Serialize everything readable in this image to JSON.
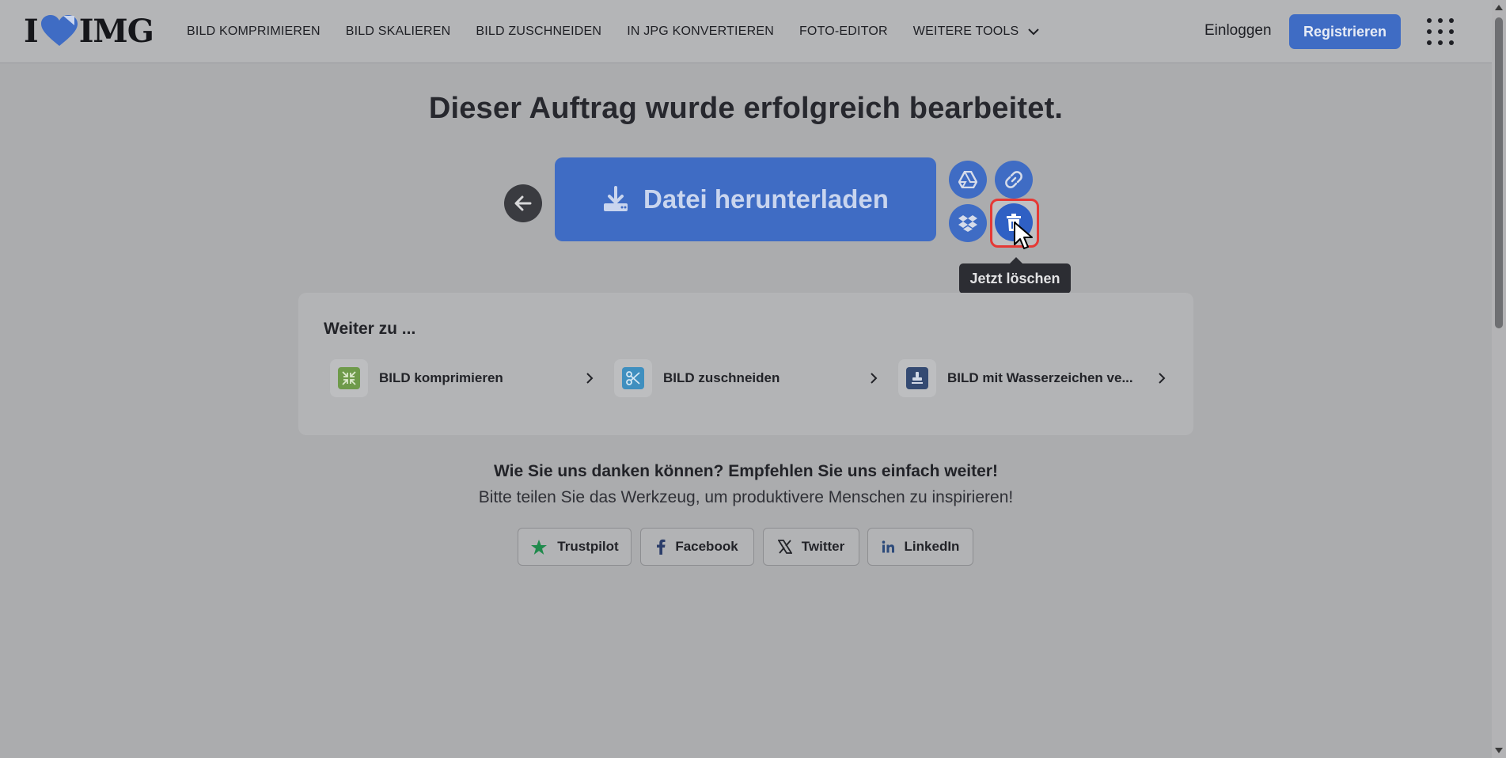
{
  "header": {
    "logo_text_left": "I",
    "logo_text_right": "IMG",
    "nav": [
      {
        "label": "BILD KOMPRIMIEREN"
      },
      {
        "label": "BILD SKALIEREN"
      },
      {
        "label": "BILD ZUSCHNEIDEN"
      },
      {
        "label": "IN JPG KONVERTIEREN"
      },
      {
        "label": "FOTO-EDITOR"
      },
      {
        "label": "WEITERE TOOLS"
      }
    ],
    "login_label": "Einloggen",
    "register_label": "Registrieren"
  },
  "main": {
    "headline": "Dieser Auftrag wurde erfolgreich bearbeitet.",
    "download_label": "Datei herunterladen",
    "tooltip": "Jetzt löschen"
  },
  "continue": {
    "title": "Weiter zu ...",
    "items": [
      {
        "label": "BILD komprimieren",
        "color": "#6e9a4a"
      },
      {
        "label": "BILD zuschneiden",
        "color": "#3f8fbf"
      },
      {
        "label": "BILD mit Wasserzeichen ve...",
        "color": "#344a72"
      }
    ]
  },
  "share": {
    "question": "Wie Sie uns danken können? Empfehlen Sie uns einfach weiter!",
    "subtitle": "Bitte teilen Sie das Werkzeug, um produktivere Menschen zu inspirieren!",
    "buttons": [
      {
        "label": "Trustpilot"
      },
      {
        "label": "Facebook"
      },
      {
        "label": "Twitter"
      },
      {
        "label": "LinkedIn"
      }
    ]
  },
  "colors": {
    "accent": "#3f6cc4",
    "highlight": "#e53935",
    "trustpilot": "#1f8a4c"
  }
}
